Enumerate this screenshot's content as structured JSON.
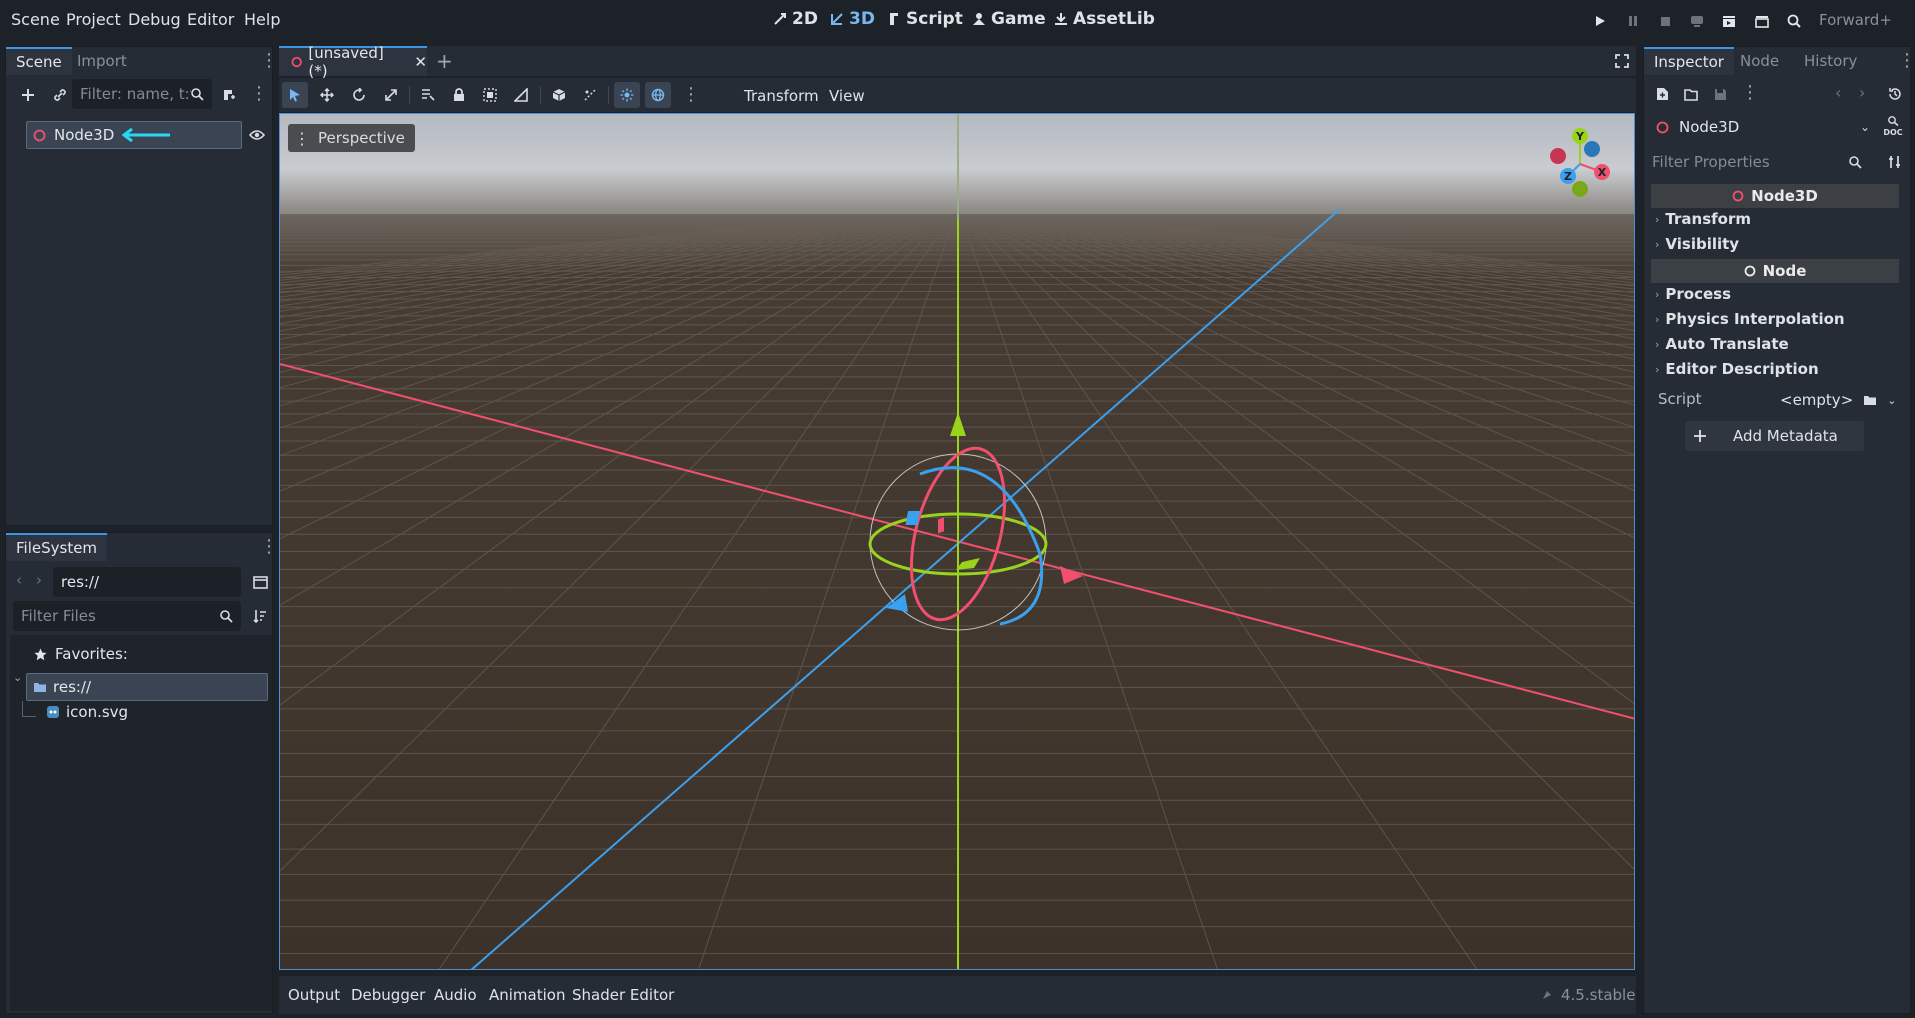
{
  "menu": {
    "items": [
      "Scene",
      "Project",
      "Debug",
      "Editor",
      "Help"
    ]
  },
  "workspaces": {
    "items": [
      "2D",
      "3D",
      "Script",
      "Game",
      "AssetLib"
    ],
    "active": "3D"
  },
  "renderer": "Forward+",
  "scene_dock": {
    "tabs": [
      "Scene",
      "Import"
    ],
    "filter_placeholder": "Filter: name, t:t",
    "root_node": "Node3D"
  },
  "filesystem_dock": {
    "tab": "FileSystem",
    "path": "res://",
    "filter_placeholder": "Filter Files",
    "favorites_label": "Favorites:",
    "root_folder": "res://",
    "files": [
      "icon.svg"
    ]
  },
  "editor": {
    "scene_tab": "[unsaved](*)",
    "toolbar_menus": [
      "Transform",
      "View"
    ],
    "viewport_label": "Perspective",
    "gizmo_axes": {
      "x": "X",
      "y": "Y",
      "z": "Z"
    }
  },
  "inspector": {
    "tabs": [
      "Inspector",
      "Node",
      "History"
    ],
    "selected_node": "Node3D",
    "filter_placeholder": "Filter Properties",
    "doc_label": "DOC",
    "sections": [
      {
        "header": "Node3D",
        "items": [
          "Transform",
          "Visibility"
        ]
      },
      {
        "header": "Node",
        "items": [
          "Process",
          "Physics Interpolation",
          "Auto Translate",
          "Editor Description"
        ]
      }
    ],
    "script_label": "Script",
    "script_value": "<empty>",
    "add_metadata_label": "Add Metadata"
  },
  "bottom_panel": {
    "tabs": [
      "Output",
      "Debugger",
      "Audio",
      "Animation",
      "Shader Editor"
    ],
    "version": "4.5.stable"
  },
  "colors": {
    "accent": "#3e95e0",
    "x_axis": "#f0506e",
    "y_axis": "#9ad31c",
    "z_axis": "#3aa0ef",
    "ground": "#3c3229"
  }
}
